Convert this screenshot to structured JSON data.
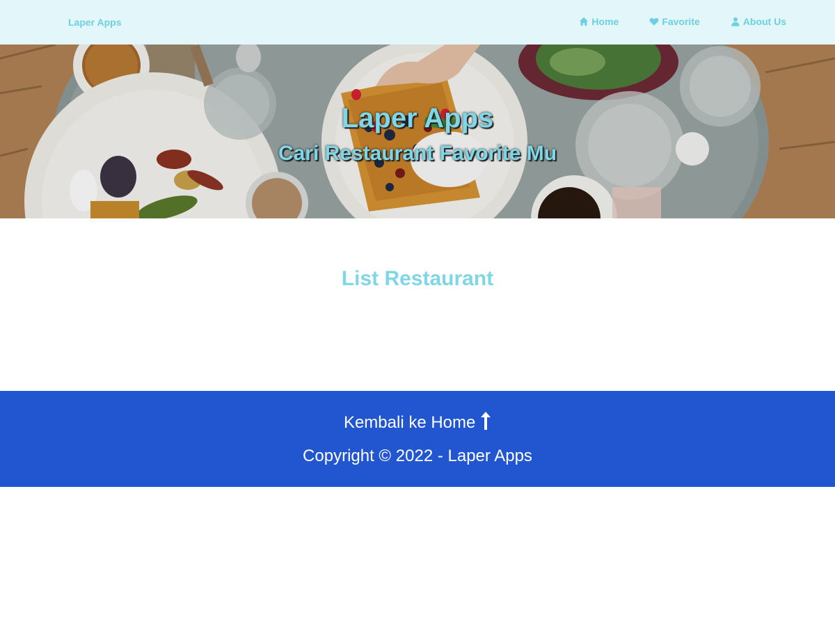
{
  "nav": {
    "brand": "Laper Apps",
    "links": [
      {
        "label": "Home",
        "icon": "home-icon"
      },
      {
        "label": "Favorite",
        "icon": "heart-icon"
      },
      {
        "label": "About Us",
        "icon": "user-icon"
      }
    ]
  },
  "hero": {
    "title": "Laper Apps",
    "subtitle": "Cari Restaurant Favorite Mu"
  },
  "main": {
    "heading": "List Restaurant"
  },
  "footer": {
    "back_label": "Kembali ke Home",
    "back_icon": "arrow-up-icon",
    "copyright": "Copyright © 2022 - Laper Apps"
  },
  "colors": {
    "nav_bg": "#e3f7fb",
    "accent": "#7fd6e6",
    "footer_bg": "#2156d0"
  }
}
